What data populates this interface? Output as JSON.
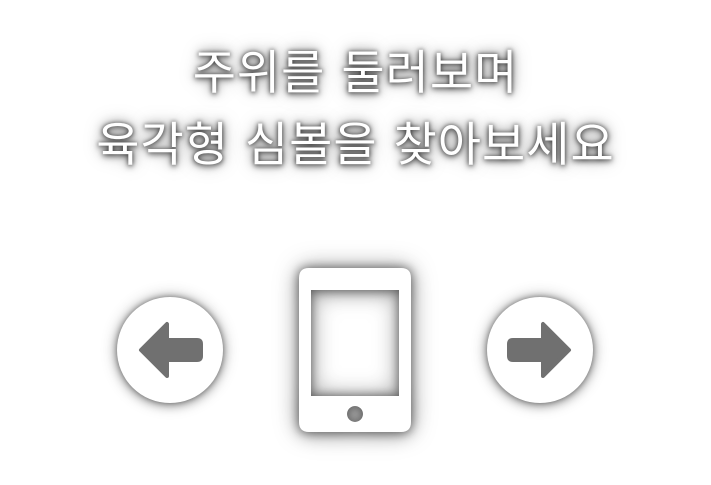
{
  "instruction": {
    "line1": "주위를 둘러보며",
    "line2": "육각형 심볼을 찾아보세요"
  },
  "controls": {
    "prev_icon": "arrow-left-icon",
    "next_icon": "arrow-right-icon",
    "device_icon": "tablet-icon"
  },
  "colors": {
    "foreground": "#ffffff",
    "arrow": "#707070",
    "shadow": "#000000"
  }
}
